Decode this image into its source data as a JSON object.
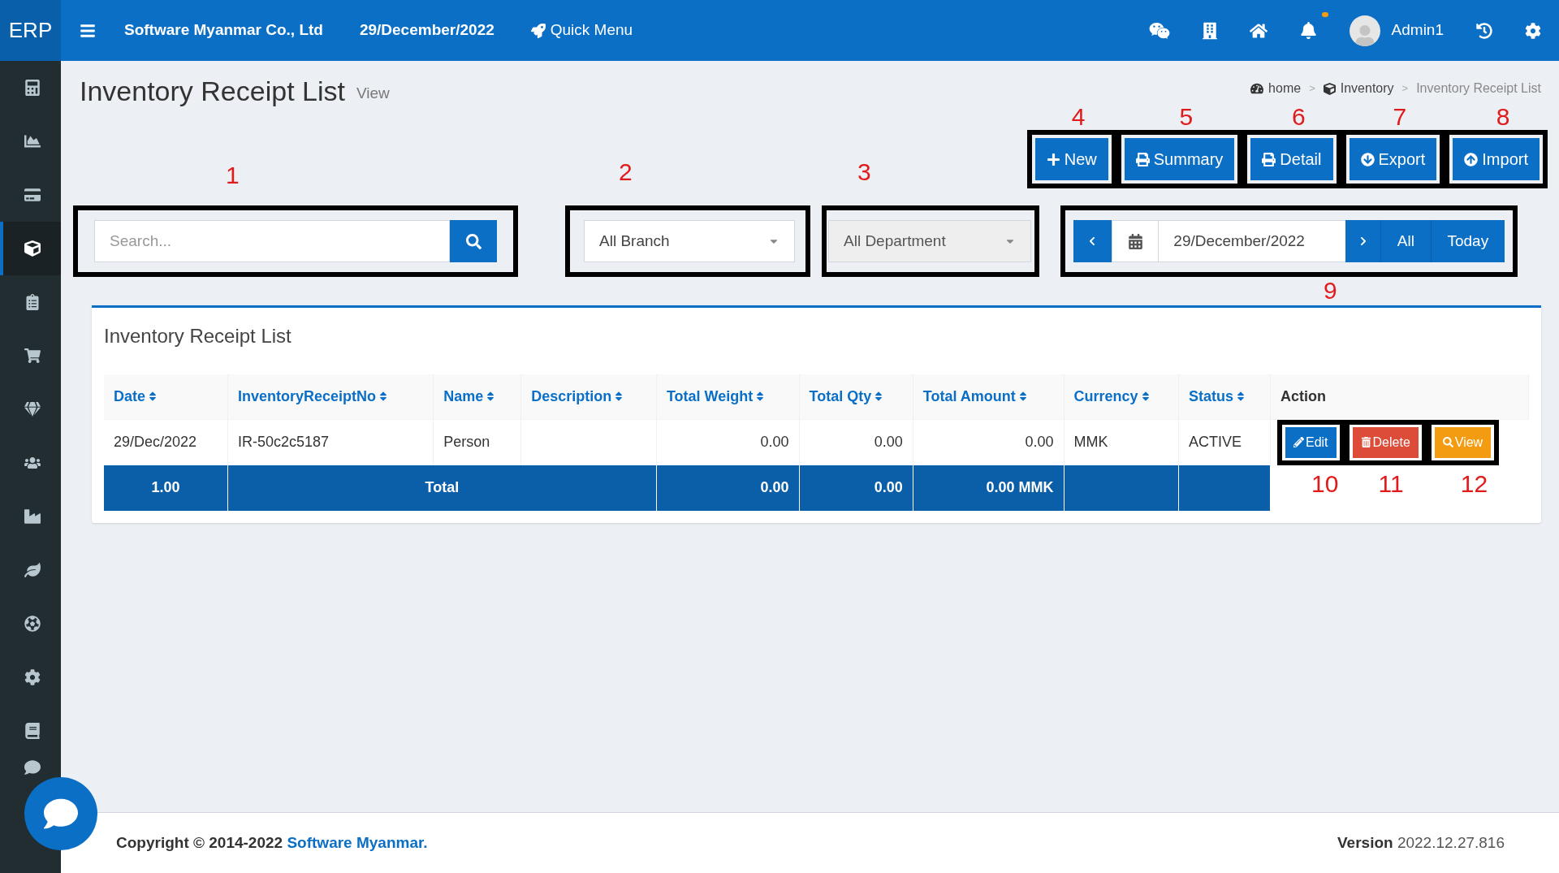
{
  "header": {
    "logo": "ERP",
    "company": "Software Myanmar Co., Ltd",
    "date": "29/December/2022",
    "quick_menu": "Quick Menu",
    "unread_notifications": true,
    "user": "Admin1"
  },
  "sidebar": {
    "items": [
      {
        "selected": false
      },
      {
        "selected": false
      },
      {
        "selected": false
      },
      {
        "selected": true
      },
      {
        "selected": false
      },
      {
        "selected": false
      },
      {
        "selected": false
      },
      {
        "selected": false
      },
      {
        "selected": false
      },
      {
        "selected": false
      },
      {
        "selected": false
      },
      {
        "selected": false
      },
      {
        "selected": false
      },
      {
        "selected": false
      }
    ]
  },
  "page": {
    "title": "Inventory Receipt List",
    "subtitle": "View"
  },
  "breadcrumb": [
    {
      "label": "home"
    },
    {
      "label": "Inventory"
    },
    {
      "label": "Inventory Receipt List"
    }
  ],
  "breadcrumb_separator": ">",
  "actions": [
    {
      "label": "New",
      "annotation": "4"
    },
    {
      "label": "Summary",
      "annotation": "5"
    },
    {
      "label": "Detail",
      "annotation": "6"
    },
    {
      "label": "Export",
      "annotation": "7"
    },
    {
      "label": "Import",
      "annotation": "8"
    }
  ],
  "search": {
    "placeholder": "Search...",
    "annotation": "1"
  },
  "branch": {
    "value": "All Branch",
    "annotation": "2",
    "disabled": false
  },
  "department": {
    "value": "All Department",
    "annotation": "3",
    "disabled": true
  },
  "date_filter": {
    "value": "29/December/2022",
    "all": "All",
    "today": "Today",
    "annotation": "9"
  },
  "card": {
    "title": "Inventory Receipt List"
  },
  "table": {
    "columns": [
      {
        "label": "Date",
        "sortable": true
      },
      {
        "label": "InventoryReceiptNo",
        "sortable": true
      },
      {
        "label": "Name",
        "sortable": true
      },
      {
        "label": "Description",
        "sortable": true
      },
      {
        "label": "Total Weight",
        "sortable": true
      },
      {
        "label": "Total Qty",
        "sortable": true
      },
      {
        "label": "Total Amount",
        "sortable": true
      },
      {
        "label": "Currency",
        "sortable": true
      },
      {
        "label": "Status",
        "sortable": true
      },
      {
        "label": "Action",
        "sortable": false
      }
    ],
    "rows": [
      {
        "cells": [
          "29/Dec/2022",
          "IR-50c2c5187",
          "Person",
          "",
          "0.00",
          "0.00",
          "0.00",
          "MMK",
          "ACTIVE"
        ],
        "buttons": [
          {
            "kind": "edit",
            "label": "Edit",
            "annotation": "10"
          },
          {
            "kind": "delete",
            "label": "Delete",
            "annotation": "11"
          },
          {
            "kind": "view",
            "label": "View",
            "annotation": "12"
          }
        ]
      }
    ],
    "total": [
      "1.00",
      "Total",
      "0.00",
      "0.00",
      "0.00 MMK"
    ]
  },
  "footer": {
    "copyright": "Copyright © 2014-2022",
    "company": "Software Myanmar.",
    "version_label": "Version",
    "version": "2022.12.27.816"
  }
}
